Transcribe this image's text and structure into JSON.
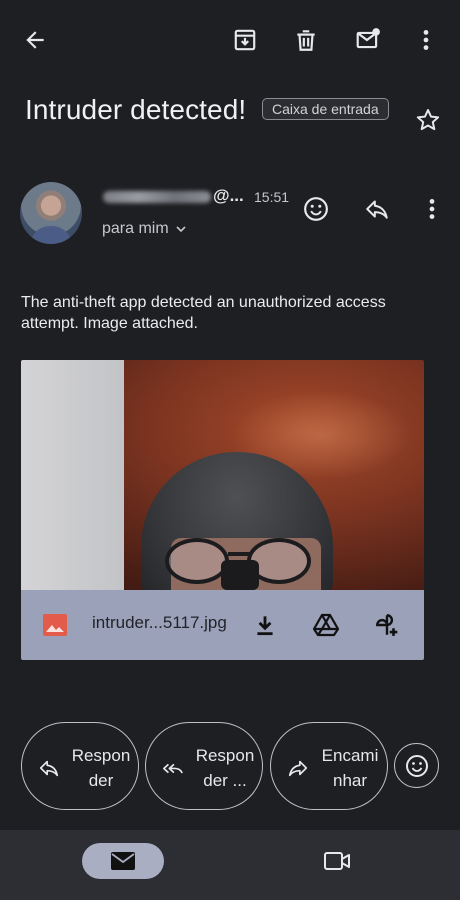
{
  "toolbar": {
    "back": "back-arrow-icon",
    "archive": "archive-icon",
    "delete": "trash-icon",
    "mark_unread": "mark-unread-icon",
    "more": "more-vert-icon"
  },
  "email": {
    "subject": "Intruder detected!",
    "label": "Caixa de entrada",
    "sender_suffix": "@...",
    "time": "15:51",
    "recipient": "para mim",
    "body": "The anti-theft app detected an unauthorized access attempt. Image attached."
  },
  "attachment": {
    "filename": "intruder...5117.jpg"
  },
  "actions": {
    "reply": "Responder",
    "reply_all": "Responder ...",
    "forward": "Encaminhar"
  },
  "colors": {
    "background": "#1e1f23",
    "attachment_bar": "#9aa1b8",
    "nav_active": "#a9aec3",
    "image_icon": "#e25b4b"
  }
}
